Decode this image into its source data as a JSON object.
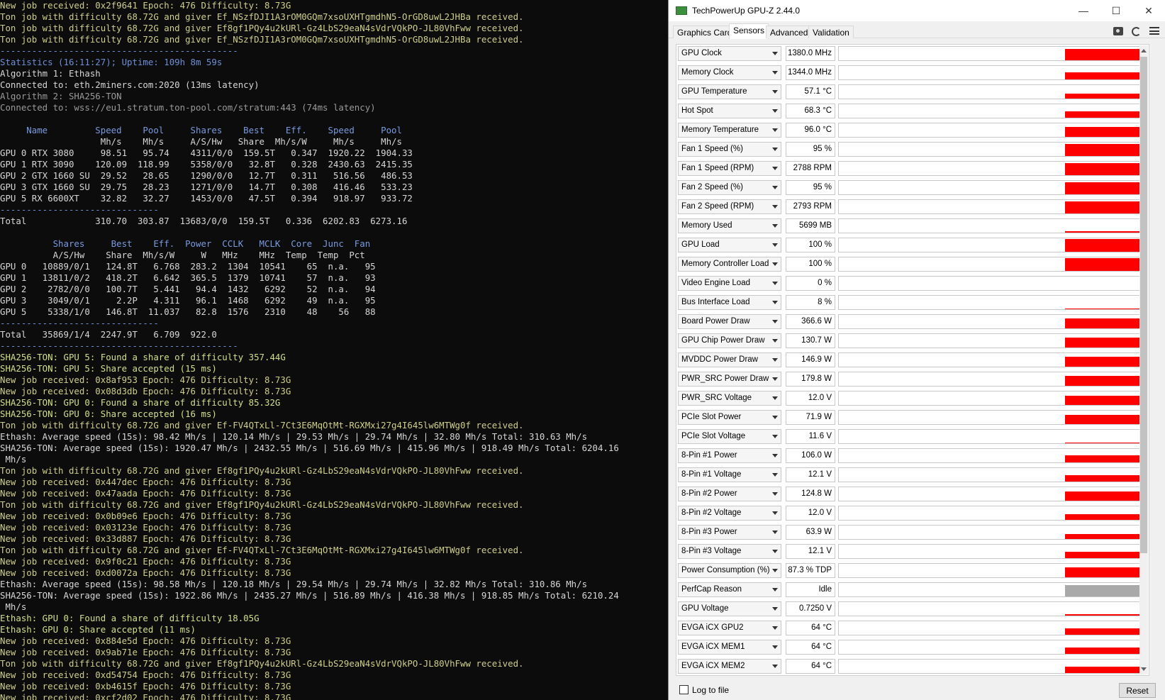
{
  "terminal": {
    "lines": [
      {
        "t": "New job received: 0x2f9641 Epoch: 476 Difficulty: 8.73G",
        "c": "y"
      },
      {
        "t": "Ton job with difficulty 68.72G and giver Ef_NSzfDJI1A3rOM0GQm7xsoUXHTgmdhN5-OrGD8uwL2JHBa received.",
        "c": "y"
      },
      {
        "t": "Ton job with difficulty 68.72G and giver Ef8gf1PQy4u2kURl-Gz4LbS29eaN4sVdrVQkPO-JL80VhFww received.",
        "c": "y"
      },
      {
        "t": "Ton job with difficulty 68.72G and giver Ef_NSzfDJI1A3rOM0GQm7xsoUXHTgmdhN5-OrGD8uwL2JHBa received.",
        "c": "y"
      },
      {
        "t": "---------------------------------------------",
        "c": "b"
      },
      {
        "t": "Statistics (16:11:27); Uptime: 109h 8m 59s",
        "c": "b"
      },
      {
        "t": "Algorithm 1: Ethash",
        "c": "w"
      },
      {
        "t": "Connected to: eth.2miners.com:2020 (13ms latency)",
        "c": "w"
      },
      {
        "t": "Algorithm 2: SHA256-TON",
        "c": "gr"
      },
      {
        "t": "Connected to: wss://eu1.stratum.ton-pool.com/stratum:443 (74ms latency)",
        "c": "gr"
      },
      {
        "t": "",
        "c": "w"
      },
      {
        "t": "     Name         Speed    Pool     Shares    Best    Eff.    Speed     Pool",
        "c": "h"
      },
      {
        "t": "                   Mh/s    Mh/s     A/S/Hw   Share  Mh/s/W     Mh/s     Mh/s",
        "c": "w"
      },
      {
        "t": "GPU 0 RTX 3080     98.51   95.74    4311/0/0  159.5T   0.347  1920.22  1904.33",
        "c": "w"
      },
      {
        "t": "GPU 1 RTX 3090    120.09  118.99    5358/0/0   32.8T   0.328  2430.63  2415.35",
        "c": "w"
      },
      {
        "t": "GPU 2 GTX 1660 SU  29.52   28.65    1290/0/0   12.7T   0.311   516.56   486.53",
        "c": "w"
      },
      {
        "t": "GPU 3 GTX 1660 SU  29.75   28.23    1271/0/0   14.7T   0.308   416.46   533.23",
        "c": "w"
      },
      {
        "t": "GPU 5 RX 6600XT    32.82   32.27    1453/0/0   47.5T   0.394   918.97   933.72",
        "c": "w"
      },
      {
        "t": "------------------------------",
        "c": "b"
      },
      {
        "t": "Total             310.70  303.87  13683/0/0  159.5T   0.336  6202.83  6273.16",
        "c": "w"
      },
      {
        "t": "",
        "c": "w"
      },
      {
        "t": "          Shares     Best    Eff.  Power  CCLK   MCLK  Core  Junc  Fan",
        "c": "h"
      },
      {
        "t": "          A/S/Hw    Share  Mh/s/W     W   MHz    MHz  Temp  Temp  Pct",
        "c": "w"
      },
      {
        "t": "GPU 0   10889/0/1   124.8T   6.768  283.2  1304  10541    65  n.a.   95",
        "c": "w"
      },
      {
        "t": "GPU 1   13811/0/2   418.2T   6.642  365.5  1379  10741    57  n.a.   93",
        "c": "w"
      },
      {
        "t": "GPU 2    2782/0/0   100.7T   5.441   94.4  1432   6292    52  n.a.   94",
        "c": "w"
      },
      {
        "t": "GPU 3    3049/0/1     2.2P   4.311   96.1  1468   6292    49  n.a.   95",
        "c": "w"
      },
      {
        "t": "GPU 5    5338/1/0   146.8T  11.037   82.8  1576   2310    48    56   88",
        "c": "w"
      },
      {
        "t": "------------------------------",
        "c": "b"
      },
      {
        "t": "Total   35869/1/4  2247.9T   6.709  922.0",
        "c": "w"
      },
      {
        "t": "---------------------------------------------",
        "c": "b"
      },
      {
        "t": "SHA256-TON: GPU 5: Found a share of difficulty 357.44G",
        "c": "g"
      },
      {
        "t": "SHA256-TON: GPU 5: Share accepted (15 ms)",
        "c": "g"
      },
      {
        "t": "New job received: 0x8af953 Epoch: 476 Difficulty: 8.73G",
        "c": "y"
      },
      {
        "t": "New job received: 0x08d3db Epoch: 476 Difficulty: 8.73G",
        "c": "y"
      },
      {
        "t": "SHA256-TON: GPU 0: Found a share of difficulty 85.32G",
        "c": "g"
      },
      {
        "t": "SHA256-TON: GPU 0: Share accepted (16 ms)",
        "c": "g"
      },
      {
        "t": "Ton job with difficulty 68.72G and giver Ef-FV4QTxLl-7Ct3E6MqOtMt-RGXMxi27g4I645lw6MTWg0f received.",
        "c": "y"
      },
      {
        "t": "Ethash: Average speed (15s): 98.42 Mh/s | 120.14 Mh/s | 29.53 Mh/s | 29.74 Mh/s | 32.80 Mh/s Total: 310.63 Mh/s",
        "c": "w"
      },
      {
        "t": "SHA256-TON: Average speed (15s): 1920.47 Mh/s | 2432.55 Mh/s | 516.69 Mh/s | 415.96 Mh/s | 918.49 Mh/s Total: 6204.16",
        "c": "w"
      },
      {
        "t": " Mh/s",
        "c": "w"
      },
      {
        "t": "Ton job with difficulty 68.72G and giver Ef8gf1PQy4u2kURl-Gz4LbS29eaN4sVdrVQkPO-JL80VhFww received.",
        "c": "y"
      },
      {
        "t": "New job received: 0x447dec Epoch: 476 Difficulty: 8.73G",
        "c": "y"
      },
      {
        "t": "New job received: 0x47aada Epoch: 476 Difficulty: 8.73G",
        "c": "y"
      },
      {
        "t": "Ton job with difficulty 68.72G and giver Ef8gf1PQy4u2kURl-Gz4LbS29eaN4sVdrVQkPO-JL80VhFww received.",
        "c": "y"
      },
      {
        "t": "New job received: 0x0b09e6 Epoch: 476 Difficulty: 8.73G",
        "c": "y"
      },
      {
        "t": "New job received: 0x03123e Epoch: 476 Difficulty: 8.73G",
        "c": "y"
      },
      {
        "t": "New job received: 0x33d887 Epoch: 476 Difficulty: 8.73G",
        "c": "y"
      },
      {
        "t": "Ton job with difficulty 68.72G and giver Ef-FV4QTxLl-7Ct3E6MqOtMt-RGXMxi27g4I645lw6MTWg0f received.",
        "c": "y"
      },
      {
        "t": "New job received: 0x9f0c21 Epoch: 476 Difficulty: 8.73G",
        "c": "y"
      },
      {
        "t": "New job received: 0xd0072a Epoch: 476 Difficulty: 8.73G",
        "c": "y"
      },
      {
        "t": "Ethash: Average speed (15s): 98.58 Mh/s | 120.18 Mh/s | 29.54 Mh/s | 29.74 Mh/s | 32.82 Mh/s Total: 310.86 Mh/s",
        "c": "w"
      },
      {
        "t": "SHA256-TON: Average speed (15s): 1922.86 Mh/s | 2435.27 Mh/s | 516.89 Mh/s | 416.38 Mh/s | 918.85 Mh/s Total: 6210.24",
        "c": "w"
      },
      {
        "t": " Mh/s",
        "c": "w"
      },
      {
        "t": "Ethash: GPU 0: Found a share of difficulty 18.05G",
        "c": "g"
      },
      {
        "t": "Ethash: GPU 0: Share accepted (11 ms)",
        "c": "g"
      },
      {
        "t": "New job received: 0x884e5d Epoch: 476 Difficulty: 8.73G",
        "c": "y"
      },
      {
        "t": "New job received: 0x9ab71e Epoch: 476 Difficulty: 8.73G",
        "c": "y"
      },
      {
        "t": "Ton job with difficulty 68.72G and giver Ef8gf1PQy4u2kURl-Gz4LbS29eaN4sVdrVQkPO-JL80VhFww received.",
        "c": "y"
      },
      {
        "t": "New job received: 0xd54754 Epoch: 476 Difficulty: 8.73G",
        "c": "y"
      },
      {
        "t": "New job received: 0xb4615f Epoch: 476 Difficulty: 8.73G",
        "c": "y"
      },
      {
        "t": "New job received: 0xcf2d02 Epoch: 476 Difficulty: 8.73G",
        "c": "y"
      }
    ]
  },
  "gpuz": {
    "title": "TechPowerUp GPU-Z 2.44.0",
    "window_buttons": {
      "minimize": "—",
      "maximize": "☐",
      "close": "✕"
    },
    "tabs": [
      "Graphics Card",
      "Sensors",
      "Advanced",
      "Validation"
    ],
    "active_tab": "Sensors",
    "accent_color": "#ff0000",
    "sensors": [
      {
        "name": "GPU Clock",
        "value": "1380.0 MHz",
        "level": 0.85
      },
      {
        "name": "Memory Clock",
        "value": "1344.0 MHz",
        "level": 0.5
      },
      {
        "name": "GPU Temperature",
        "value": "57.1 °C",
        "level": 0.35
      },
      {
        "name": "Hot Spot",
        "value": "68.3 °C",
        "level": 0.45
      },
      {
        "name": "Memory Temperature",
        "value": "96.0 °C",
        "level": 0.75
      },
      {
        "name": "Fan 1 Speed (%)",
        "value": "95 %",
        "level": 0.9
      },
      {
        "name": "Fan 1 Speed (RPM)",
        "value": "2788 RPM",
        "level": 0.9
      },
      {
        "name": "Fan 2 Speed (%)",
        "value": "95 %",
        "level": 0.9
      },
      {
        "name": "Fan 2 Speed (RPM)",
        "value": "2793 RPM",
        "level": 0.9
      },
      {
        "name": "Memory Used",
        "value": "5699 MB",
        "level": 0.1
      },
      {
        "name": "GPU Load",
        "value": "100 %",
        "level": 0.95
      },
      {
        "name": "Memory Controller Load",
        "value": "100 %",
        "level": 0.95
      },
      {
        "name": "Video Engine Load",
        "value": "0 %",
        "level": 0
      },
      {
        "name": "Bus Interface Load",
        "value": "8 %",
        "level": 0.05
      },
      {
        "name": "Board Power Draw",
        "value": "366.6 W",
        "level": 0.75
      },
      {
        "name": "GPU Chip Power Draw",
        "value": "130.7 W",
        "level": 0.75
      },
      {
        "name": "MVDDC Power Draw",
        "value": "146.9 W",
        "level": 0.75
      },
      {
        "name": "PWR_SRC Power Draw",
        "value": "179.8 W",
        "level": 0.75
      },
      {
        "name": "PWR_SRC Voltage",
        "value": "12.0 V",
        "level": 0.7
      },
      {
        "name": "PCIe Slot Power",
        "value": "71.9 W",
        "level": 0.7
      },
      {
        "name": "PCIe Slot Voltage",
        "value": "11.6 V",
        "level": 0.05
      },
      {
        "name": "8-Pin #1 Power",
        "value": "106.0 W",
        "level": 0.55
      },
      {
        "name": "8-Pin #1 Voltage",
        "value": "12.1 V",
        "level": 0.45
      },
      {
        "name": "8-Pin #2 Power",
        "value": "124.8 W",
        "level": 0.7
      },
      {
        "name": "8-Pin #2 Voltage",
        "value": "12.0 V",
        "level": 0.4
      },
      {
        "name": "8-Pin #3 Power",
        "value": "63.9 W",
        "level": 0.35
      },
      {
        "name": "8-Pin #3 Voltage",
        "value": "12.1 V",
        "level": 0.45
      },
      {
        "name": "Power Consumption (%)",
        "value": "87.3 % TDP",
        "level": 0.75
      },
      {
        "name": "PerfCap Reason",
        "value": "Idle",
        "level": 0.85,
        "idle": true
      },
      {
        "name": "GPU Voltage",
        "value": "0.7250 V",
        "level": 0.1
      },
      {
        "name": "EVGA iCX GPU2",
        "value": "64 °C",
        "level": 0.45
      },
      {
        "name": "EVGA iCX MEM1",
        "value": "64 °C",
        "level": 0.45
      },
      {
        "name": "EVGA iCX MEM2",
        "value": "64 °C",
        "level": 0.45
      }
    ],
    "log_to_file_label": "Log to file",
    "log_to_file_checked": false,
    "reset_label": "Reset"
  }
}
